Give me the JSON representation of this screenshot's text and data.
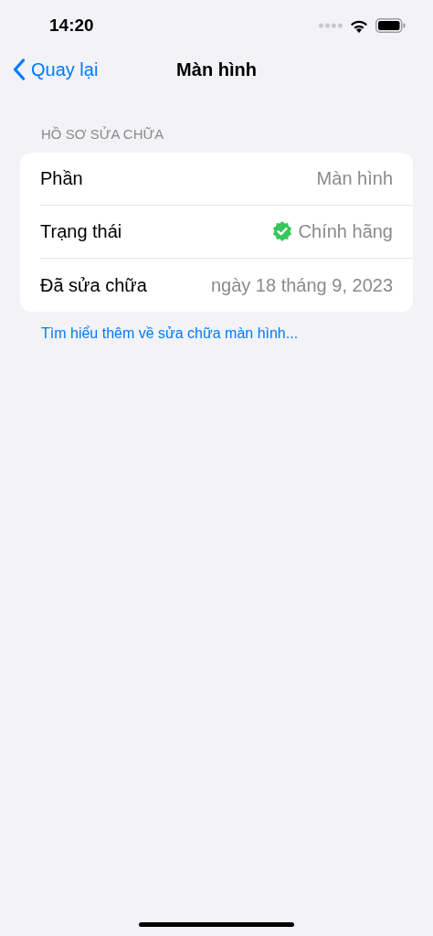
{
  "status_bar": {
    "time": "14:20"
  },
  "nav": {
    "back": "Quay lại",
    "title": "Màn hình"
  },
  "section": {
    "header": "HỒ SƠ SỬA CHỮA",
    "rows": [
      {
        "kind": "plain",
        "label": "Phần",
        "value": "Màn hình"
      },
      {
        "kind": "verified",
        "label": "Trạng thái",
        "value": "Chính hãng"
      },
      {
        "kind": "plain",
        "label": "Đã sửa chữa",
        "value": "ngày 18 tháng 9, 2023"
      }
    ],
    "footer_link": "Tìm hiểu thêm về sửa chữa màn hình..."
  }
}
